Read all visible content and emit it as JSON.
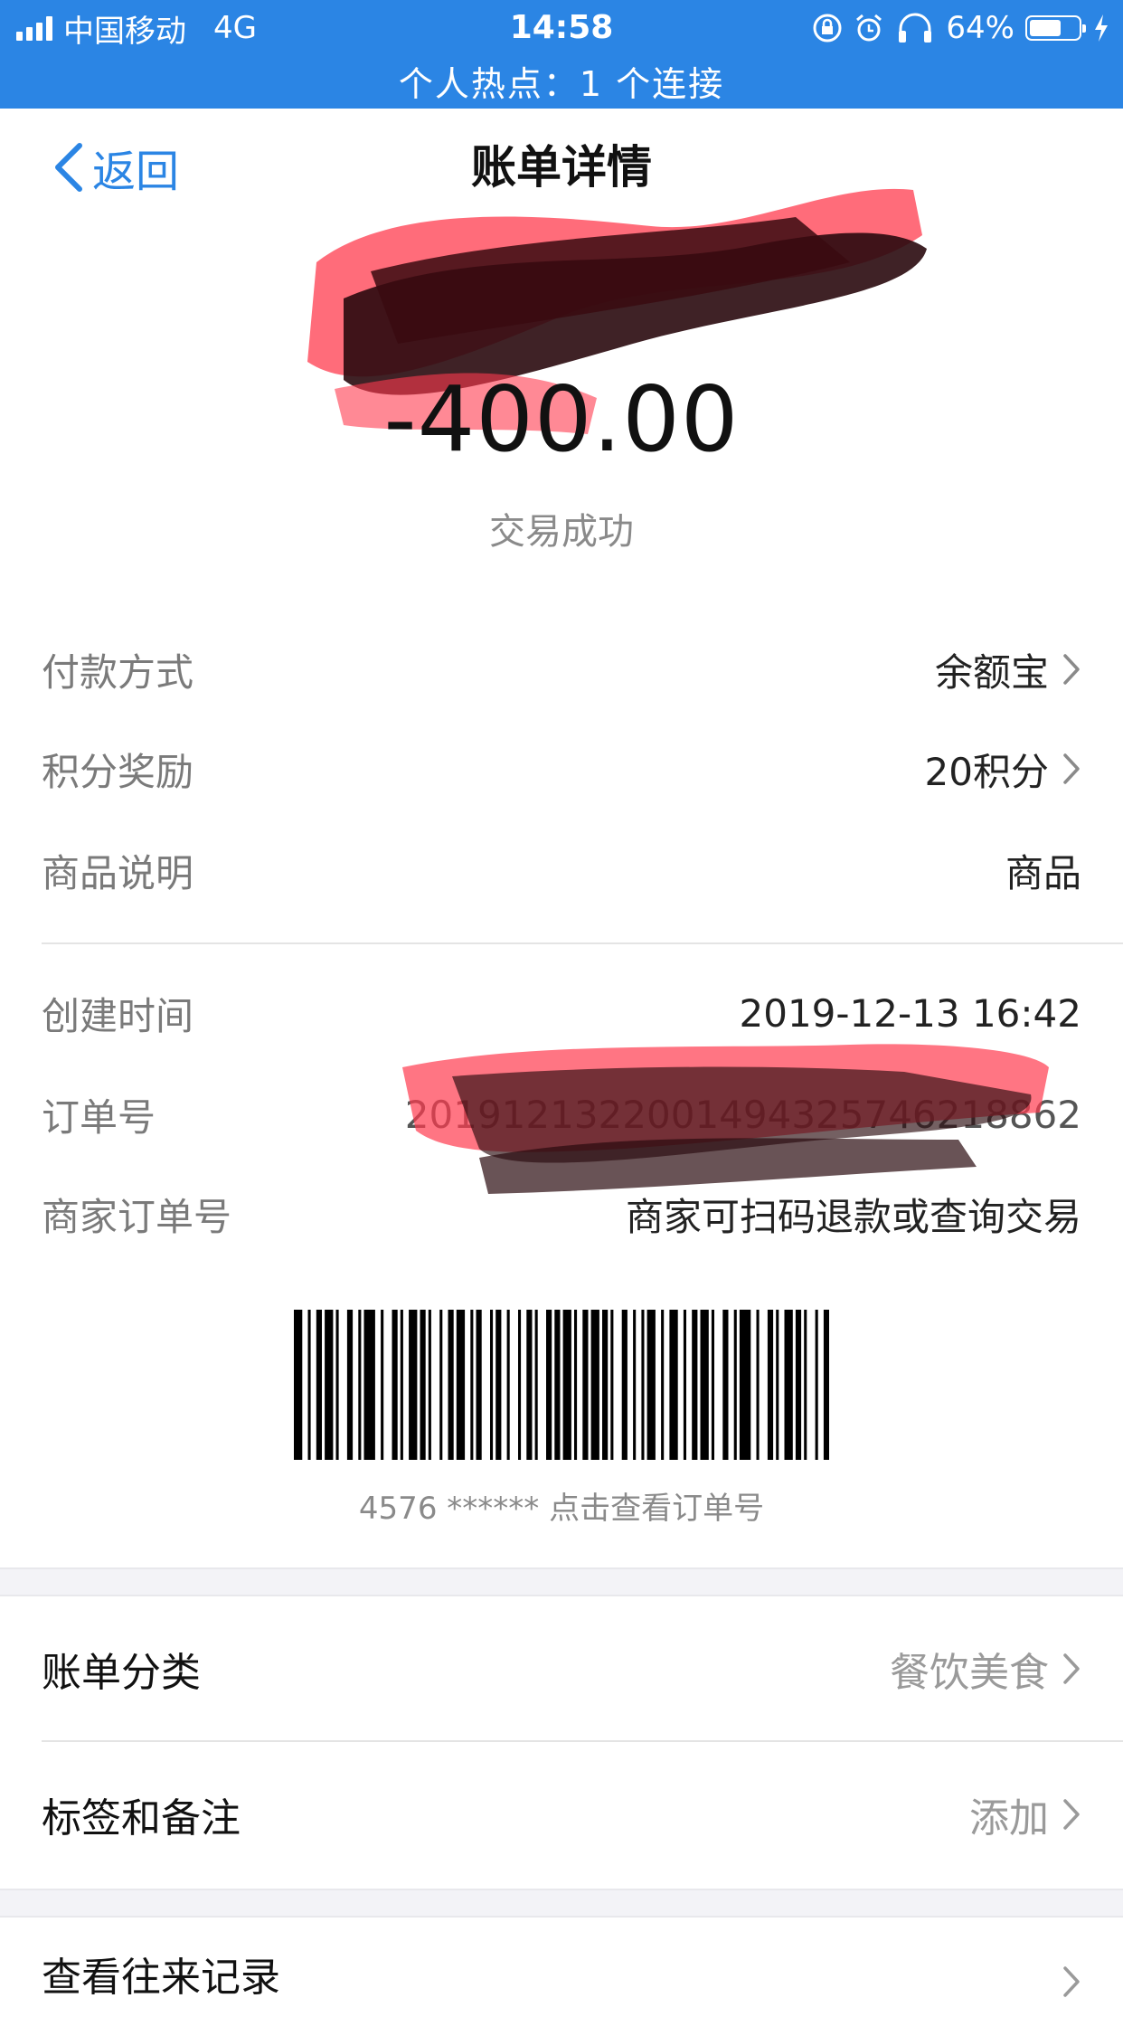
{
  "status_bar": {
    "carrier": "中国移动",
    "network": "4G",
    "time": "14:58",
    "battery": "64%",
    "battery_level": 0.64,
    "hotspot": "个人热点：1 个连接"
  },
  "nav": {
    "back_label": "返回",
    "title": "账单详情"
  },
  "summary": {
    "amount": "-400.00",
    "status": "交易成功"
  },
  "details": [
    {
      "label": "付款方式",
      "value": "余额宝",
      "chevron": true
    },
    {
      "label": "积分奖励",
      "value": "20积分",
      "chevron": true
    },
    {
      "label": "商品说明",
      "value": "商品",
      "chevron": false
    }
  ],
  "order": [
    {
      "label": "创建时间",
      "value": "2019-12-13 16:42"
    },
    {
      "label": "订单号",
      "value": "2019121322001494325746218862"
    },
    {
      "label": "商家订单号",
      "value": "商家可扫码退款或查询交易"
    }
  ],
  "barcode_caption": "4576 ****** 点击查看订单号",
  "category": {
    "label": "账单分类",
    "value": "餐饮美食"
  },
  "tags": {
    "label": "标签和备注",
    "value": "添加"
  },
  "history": {
    "label": "查看往来记录"
  },
  "colors": {
    "accent": "#2b85e4",
    "redact_red": "#ff3b4e",
    "redact_dark": "#2a0a0e"
  }
}
